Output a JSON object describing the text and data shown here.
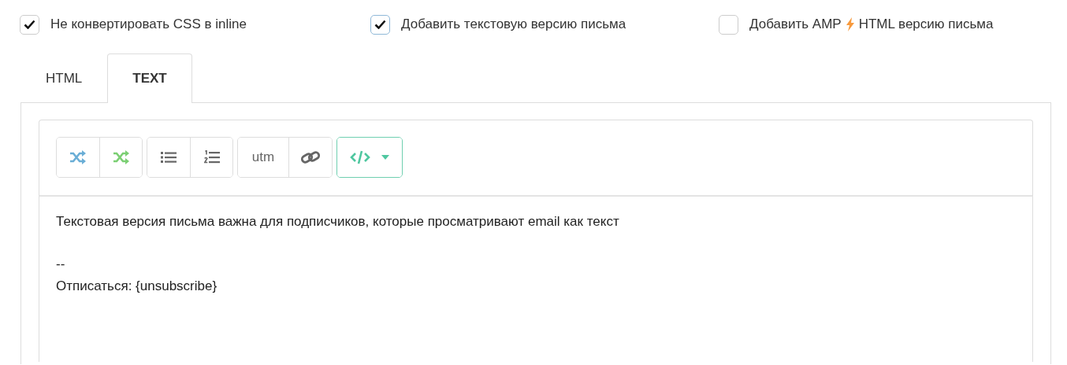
{
  "options": [
    {
      "label": "Не конвертировать CSS в inline",
      "checked": true
    },
    {
      "label": "Добавить текстовую версию письма",
      "checked": true
    },
    {
      "label": "Добавить AMP",
      "label_after": "HTML версию письма",
      "checked": false
    }
  ],
  "tabs": [
    {
      "label": "HTML",
      "selected": false
    },
    {
      "label": "TEXT",
      "selected": true
    }
  ],
  "toolbar": [
    [
      {
        "kind": "shuffle",
        "color": "#6aaed6"
      },
      {
        "kind": "shuffle",
        "color": "#7bcf73"
      }
    ],
    [
      {
        "kind": "bullets"
      },
      {
        "kind": "numbers"
      }
    ],
    [
      {
        "kind": "text",
        "label": "utm"
      },
      {
        "kind": "link"
      }
    ],
    [
      {
        "kind": "code-menu"
      }
    ]
  ],
  "editor": {
    "value": "Текстовая версия письма важна для подписчиков, которые просматривают email как текст\n\n--\nОтписаться: {unsubscribe}"
  }
}
